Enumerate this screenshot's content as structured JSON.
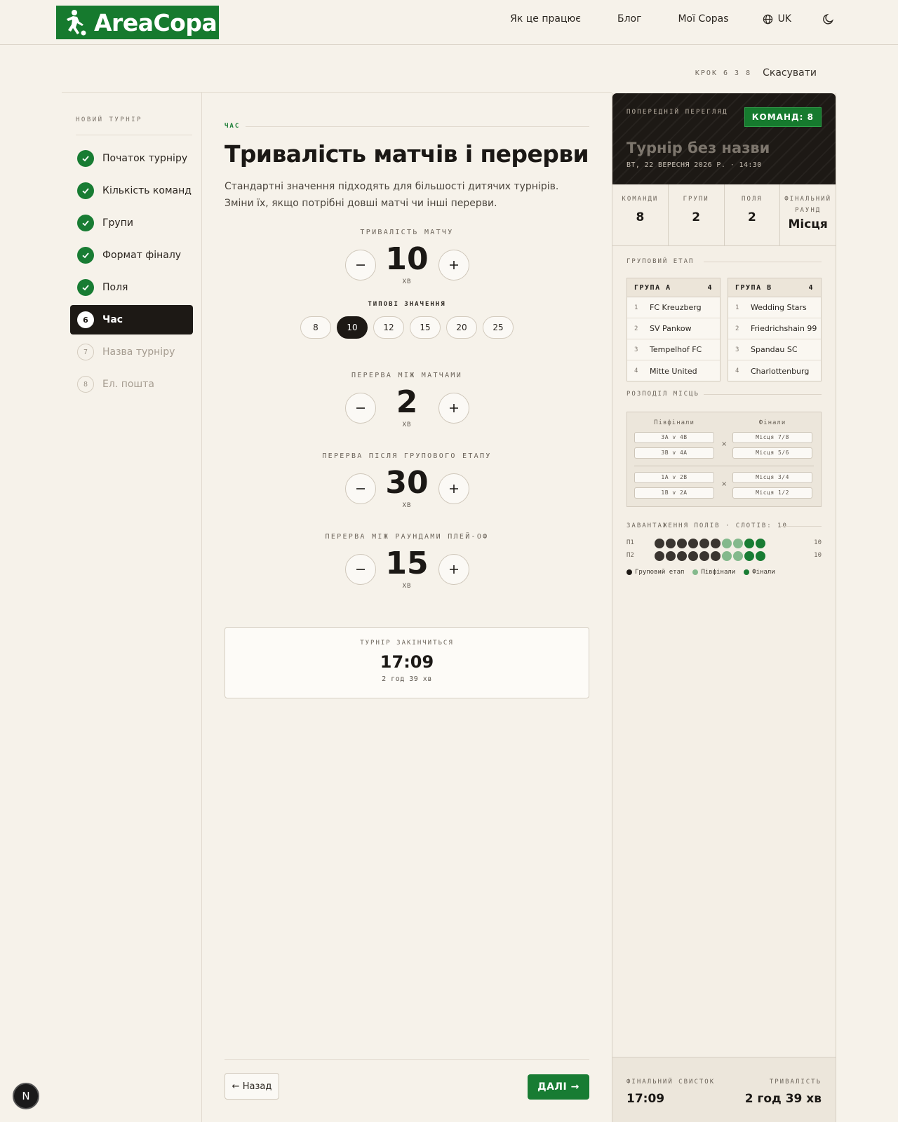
{
  "header": {
    "logo_text": "AreaCopa",
    "nav": [
      "Як це працює",
      "Блог",
      "Мої Copas"
    ],
    "language": "UK",
    "icons": {
      "language": "globe-icon",
      "theme": "moon-icon"
    }
  },
  "step_line": {
    "counter": "КРОК 6 З 8",
    "cancel": "Скасувати"
  },
  "sidebar": {
    "title": "НОВИЙ ТУРНІР",
    "steps": [
      {
        "num": "1",
        "label": "Початок турніру",
        "state": "done"
      },
      {
        "num": "2",
        "label": "Кількість команд",
        "state": "done"
      },
      {
        "num": "3",
        "label": "Групи",
        "state": "done"
      },
      {
        "num": "4",
        "label": "Формат фіналу",
        "state": "done"
      },
      {
        "num": "5",
        "label": "Поля",
        "state": "done"
      },
      {
        "num": "6",
        "label": "Час",
        "state": "active"
      },
      {
        "num": "7",
        "label": "Назва турніру",
        "state": "todo"
      },
      {
        "num": "8",
        "label": "Ел. пошта",
        "state": "todo"
      }
    ]
  },
  "main": {
    "eyebrow": "ЧАС",
    "title": "Тривалість матчів і перерви",
    "description": "Стандартні значення підходять для більшості дитячих турнірів. Зміни їх, якщо потрібні довші матчі чи інші перерви.",
    "match_duration": {
      "label": "ТРИВАЛІСТЬ МАТЧУ",
      "value": "10",
      "unit": "ХВ",
      "presets_title": "ТИПОВІ ЗНАЧЕННЯ",
      "presets": [
        "8",
        "10",
        "12",
        "15",
        "20",
        "25"
      ],
      "selected": "10"
    },
    "break_between": {
      "label": "ПЕРЕРВА МІЖ МАТЧАМИ",
      "value": "2",
      "unit": "ХВ"
    },
    "break_after_group": {
      "label": "ПЕРЕРВА ПІСЛЯ ГРУПОВОГО ЕТАПУ",
      "value": "30",
      "unit": "ХВ"
    },
    "break_playoff": {
      "label": "ПЕРЕРВА МІЖ РАУНДАМИ ПЛЕЙ-ОФ",
      "value": "15",
      "unit": "ХВ"
    },
    "finish": {
      "label": "ТУРНІР ЗАКІНЧИТЬСЯ",
      "time": "17:09",
      "duration": "2 год 39 хв"
    },
    "back": "← Назад",
    "next": "ДАЛІ →"
  },
  "preview": {
    "eyebrow": "ПОПЕРЕДНІЙ ПЕРЕГЛЯД",
    "badge": "КОМАНД: 8",
    "title": "Турнір без назви",
    "date": "ВТ, 22 ВЕРЕСНЯ 2026 Р. · 14:30",
    "stats": [
      {
        "label": "КОМАНДИ",
        "value": "8"
      },
      {
        "label": "ГРУПИ",
        "value": "2"
      },
      {
        "label": "ПОЛЯ",
        "value": "2"
      },
      {
        "label": "ФІНАЛЬНИЙ РАУНД",
        "value": "Місця"
      }
    ],
    "group_stage_label": "ГРУПОВИЙ ЕТАП",
    "groups": [
      {
        "name": "ГРУПА А",
        "count": "4",
        "teams": [
          "FC Kreuzberg",
          "SV Pankow",
          "Tempelhof FC",
          "Mitte United"
        ]
      },
      {
        "name": "ГРУПА B",
        "count": "4",
        "teams": [
          "Wedding Stars",
          "Friedrichshain 99",
          "Spandau SC",
          "Charlottenburg"
        ]
      }
    ],
    "placement_label": "РОЗПОДІЛ МІСЦЬ",
    "bracket": {
      "semis_title": "Півфінали",
      "finals_title": "Фінали",
      "semis": [
        "3A v 4B",
        "3B v 4A",
        "1A v 2B",
        "1B v 2A"
      ],
      "finals": [
        "Місця 7/8",
        "Місця 5/6",
        "Місця 3/4",
        "Місця 1/2"
      ]
    },
    "fields_label": "ЗАВАНТАЖЕННЯ ПОЛІВ · СЛОТІВ: 10",
    "fields": [
      {
        "name": "П1",
        "count": "10",
        "slots": [
          "group",
          "group",
          "group",
          "group",
          "group",
          "group",
          "semi",
          "semi",
          "final",
          "final"
        ]
      },
      {
        "name": "П2",
        "count": "10",
        "slots": [
          "group",
          "group",
          "group",
          "group",
          "group",
          "group",
          "semi",
          "semi",
          "final",
          "final"
        ]
      }
    ],
    "colors": {
      "group": "#3a3530",
      "semi": "#84b98c",
      "final": "#187c33",
      "legend_group": "#1d1915"
    },
    "legend": [
      "Груповий етап",
      "Півфінали",
      "Фінали"
    ],
    "footer": {
      "whistle_label": "ФІНАЛЬНИЙ СВИСТОК",
      "whistle_time": "17:09",
      "duration_label": "ТРИВАЛІСТЬ",
      "duration_value": "2 год 39 хв"
    }
  },
  "fab_letter": "N"
}
